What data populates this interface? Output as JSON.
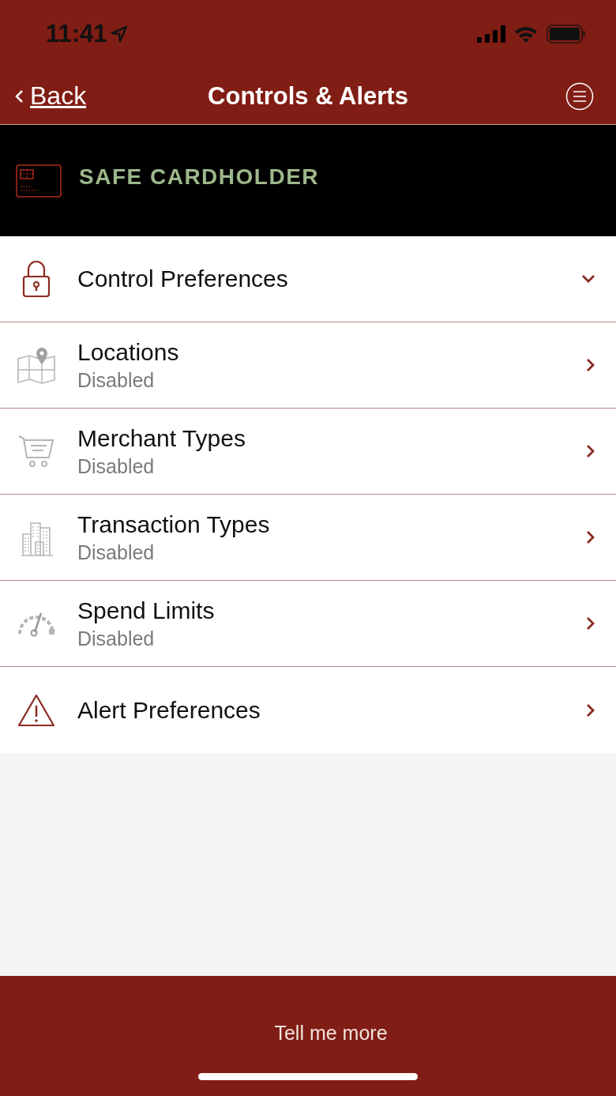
{
  "status_bar": {
    "time": "11:41"
  },
  "nav": {
    "back": "Back",
    "title": "Controls & Alerts"
  },
  "card": {
    "name": "SAFE CARDHOLDER"
  },
  "rows": [
    {
      "kind": "section",
      "label": "Control Preferences",
      "expanded": true
    },
    {
      "kind": "option",
      "label": "Locations",
      "status": "Disabled"
    },
    {
      "kind": "option",
      "label": "Merchant Types",
      "status": "Disabled"
    },
    {
      "kind": "option",
      "label": "Transaction Types",
      "status": "Disabled"
    },
    {
      "kind": "option",
      "label": "Spend Limits",
      "status": "Disabled"
    },
    {
      "kind": "section",
      "label": "Alert Preferences",
      "expanded": false
    }
  ],
  "footer": {
    "button": "Tell me more"
  }
}
